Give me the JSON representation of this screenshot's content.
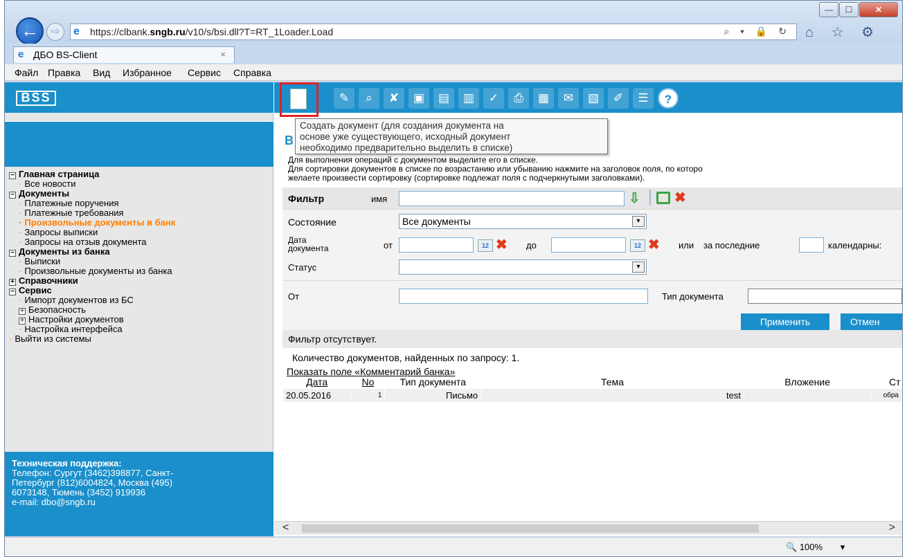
{
  "browser": {
    "url_prefix": "https://clbank.",
    "url_domain": "sngb.ru",
    "url_path": "/v10/s/bsi.dll?T=RT_1Loader.Load",
    "tab_title": "ДБО BS-Client",
    "tab_close": "×",
    "back_icon": "←",
    "forward_icon": "⇨",
    "address_icons": "⌕ ▾ 🔒 ↻",
    "toolbar_icons": "⌂ ☆ ⚙",
    "window_min": "—",
    "window_max": "☐",
    "window_close": "✕",
    "zoom": "100%",
    "zoom_icon": "🔍",
    "zoom_arrow": "▾"
  },
  "menu": {
    "file": "Файл",
    "edit": "Правка",
    "view": "Вид",
    "favorites": "Избранное",
    "service": "Сервис",
    "help": "Справка"
  },
  "sidebar": {
    "logo": "BSS",
    "items": [
      {
        "label": "Главная страница",
        "type": "group",
        "expander": "−"
      },
      {
        "label": "Все новости",
        "type": "item"
      },
      {
        "label": "Документы",
        "type": "group",
        "expander": "−"
      },
      {
        "label": "Платежные поручения",
        "type": "item"
      },
      {
        "label": "Платежные требования",
        "type": "item"
      },
      {
        "label": "Произвольные документы в банк",
        "type": "active"
      },
      {
        "label": "Запросы выписки",
        "type": "item"
      },
      {
        "label": "Запросы на отзыв документа",
        "type": "item"
      },
      {
        "label": "Документы из банка",
        "type": "group",
        "expander": "−"
      },
      {
        "label": "Выписки",
        "type": "item"
      },
      {
        "label": "Произвольные документы из банка",
        "type": "item"
      },
      {
        "label": "Справочники",
        "type": "group",
        "expander": "+"
      },
      {
        "label": "Сервис",
        "type": "group",
        "expander": "−"
      },
      {
        "label": "Импорт документов из БС",
        "type": "item"
      },
      {
        "label": "Безопасность",
        "type": "subgroup",
        "expander": "+"
      },
      {
        "label": "Настройки документов",
        "type": "subgroup",
        "expander": "+"
      },
      {
        "label": "Настройка интерфейса",
        "type": "item"
      },
      {
        "label": "Выйти из системы",
        "type": "exit"
      }
    ],
    "support_title": "Техническая поддержка:",
    "support_line1": "Телефон: Сургут (3462)398877, Санкт-",
    "support_line2": "Петербург (812)6004824, Москва (495)",
    "support_line3": "6073148, Тюмень (3452) 919936",
    "support_line4": "e-mail: dbo@sngb.ru"
  },
  "toolbar": {
    "tooltip_line1": "Создать документ (для создания документа на",
    "tooltip_line2": "основе уже существующего, исходный документ",
    "tooltip_line3": "необходимо предварительно выделить в списке)",
    "icons": [
      "edit-icon",
      "view-icon",
      "delete-icon",
      "sign-icon",
      "remove-sign-icon",
      "send-icon",
      "check-icon",
      "print-icon",
      "export-icon",
      "scroll-icon",
      "archive-icon",
      "stamp-icon",
      "settings-icon",
      "help-icon"
    ],
    "help_glyph": "?"
  },
  "main": {
    "section_letter": "В",
    "help_line1": "Для выполнения операций с документом выделите его в списке.",
    "help_line2": "Для сортировки документов в списке по возрастанию или убыванию нажмите на заголовок поля, по которо",
    "help_line3": "желаете произвести сортировку (сортировке подлежат поля с подчеркнутыми заголовками).",
    "filter": {
      "title": "Фильтр",
      "name_label": "имя",
      "state_label": "Состояние",
      "state_value": "Все документы",
      "date_label_1": "Дата",
      "date_label_2": "документа",
      "from_label": "от",
      "to_label": "до",
      "or_label": "или",
      "last_label": "за последние",
      "calendar_label": "календарны:",
      "status_label": "Статус",
      "from_field_label": "От",
      "doc_type_label": "Тип документа",
      "apply_button": "Применить",
      "cancel_button": "Отмен",
      "calendar_glyph": "12",
      "dropdown_arrow": "▾"
    },
    "filter_status": "Фильтр отсутствует.",
    "count_text": "Количество  документов, найденных по запросу:  1.",
    "show_comment": "Показать поле «Комментарий банка»",
    "table": {
      "headers": [
        "Дата",
        "No",
        "Тип документа",
        "Тема",
        "Вложение",
        "Ст"
      ],
      "rows": [
        {
          "date": "20.05.2016",
          "no": "1",
          "type": "Письмо",
          "subject": "test",
          "attachment": "",
          "status": "обра"
        }
      ]
    },
    "scroll_left": "<",
    "scroll_right": ">"
  }
}
